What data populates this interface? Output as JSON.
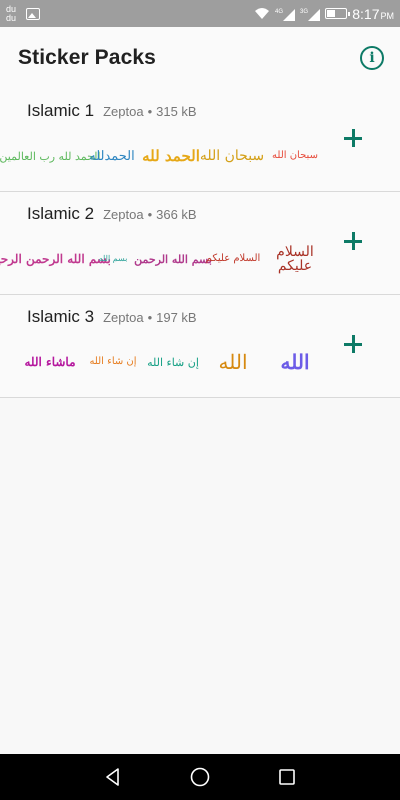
{
  "status_bar": {
    "notification_text": "du du",
    "network_4g": "4G",
    "network_3g": "3G",
    "time": "8:17",
    "ampm": "PM"
  },
  "app_bar": {
    "title": "Sticker Packs",
    "info_icon": "info-icon",
    "info_glyph": "i"
  },
  "packs": [
    {
      "name": "Islamic 1",
      "publisher": "Zeptoa",
      "separator": "•",
      "size": "315 kB",
      "stickers": [
        {
          "text": "الحمد لله رب العالمين",
          "color": "#5cb85c"
        },
        {
          "text": "الحمدلله",
          "color": "#2e86c1"
        },
        {
          "text": "الحمد لله",
          "color": "#e6a817"
        },
        {
          "text": "سبحان الله",
          "color": "#d4a017"
        },
        {
          "text": "سبحان الله",
          "color": "#e74c3c"
        }
      ]
    },
    {
      "name": "Islamic 2",
      "publisher": "Zeptoa",
      "separator": "•",
      "size": "366 kB",
      "stickers": [
        {
          "text": "بسم الله الرحمن الرحيم",
          "color": "#c0398f"
        },
        {
          "text": "بسم الله",
          "color": "#2aa198"
        },
        {
          "text": "بسم الله الرحمن",
          "color": "#b03a8c"
        },
        {
          "text": "السلام عليكم",
          "color": "#c0392b"
        },
        {
          "text": "السلام عليكم",
          "color": "#a93226"
        }
      ]
    },
    {
      "name": "Islamic 3",
      "publisher": "Zeptoa",
      "separator": "•",
      "size": "197 kB",
      "stickers": [
        {
          "text": "ماشاء الله",
          "color": "#b5179e"
        },
        {
          "text": "إن شاء الله",
          "color": "#e67e22"
        },
        {
          "text": "إن شاء الله",
          "color": "#16a085"
        },
        {
          "text": "الله",
          "color": "#d68910"
        },
        {
          "text": "الله",
          "color": "#6c5ce7"
        }
      ]
    }
  ],
  "add_icon": "plus-icon",
  "nav_bar": {
    "back_icon": "back-icon",
    "home_icon": "home-icon",
    "recents_icon": "recents-icon"
  },
  "colors": {
    "accent": "#0d7a66",
    "status_bar": "#9e9e9e",
    "nav_bar": "#000000"
  }
}
